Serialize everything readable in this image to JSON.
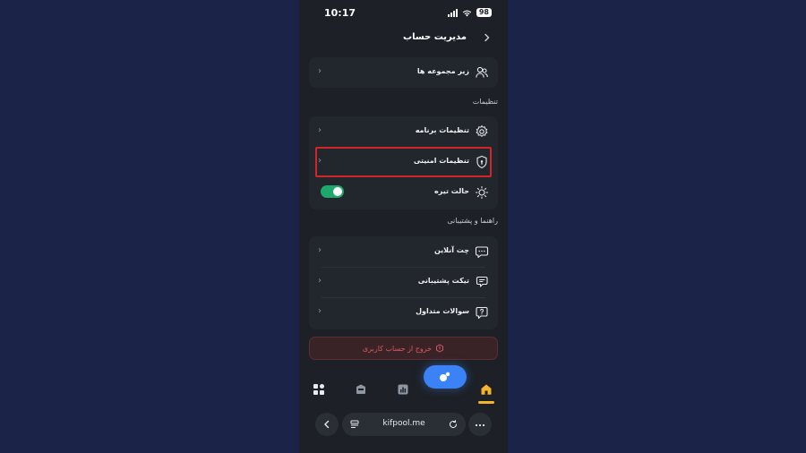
{
  "status_bar": {
    "time": "10:17",
    "battery": "98"
  },
  "header": {
    "title": "مدیریت حساب"
  },
  "subsets_card": {
    "label": "زیر مجموعه ها"
  },
  "settings_section": {
    "heading": "تنظیمات",
    "items": [
      {
        "label": "تنظیمات برنامه",
        "icon": "gear-icon"
      },
      {
        "label": "تنظیمات امنیتی",
        "icon": "shield-icon"
      },
      {
        "label": "حالت تیره",
        "icon": "sun-icon",
        "toggle_on": true
      }
    ]
  },
  "support_section": {
    "heading": "راهنما و پشتیبانی",
    "items": [
      {
        "label": "چت آنلاین",
        "icon": "chat-icon"
      },
      {
        "label": "تیکت پشتیبانی",
        "icon": "ticket-chat-icon"
      },
      {
        "label": "سوالات متداول",
        "icon": "question-icon"
      }
    ]
  },
  "logout": {
    "label": "خروج از حساب کاربری"
  },
  "browser": {
    "url": "kifpool.me"
  },
  "colors": {
    "background": "#1b2348",
    "phone_bg": "#1d2127",
    "card_bg": "#22272d",
    "accent_blue": "#3b82f6",
    "toggle_green": "#1fa86b",
    "highlight_red": "#d3242a",
    "logout_red": "#d55b62"
  }
}
